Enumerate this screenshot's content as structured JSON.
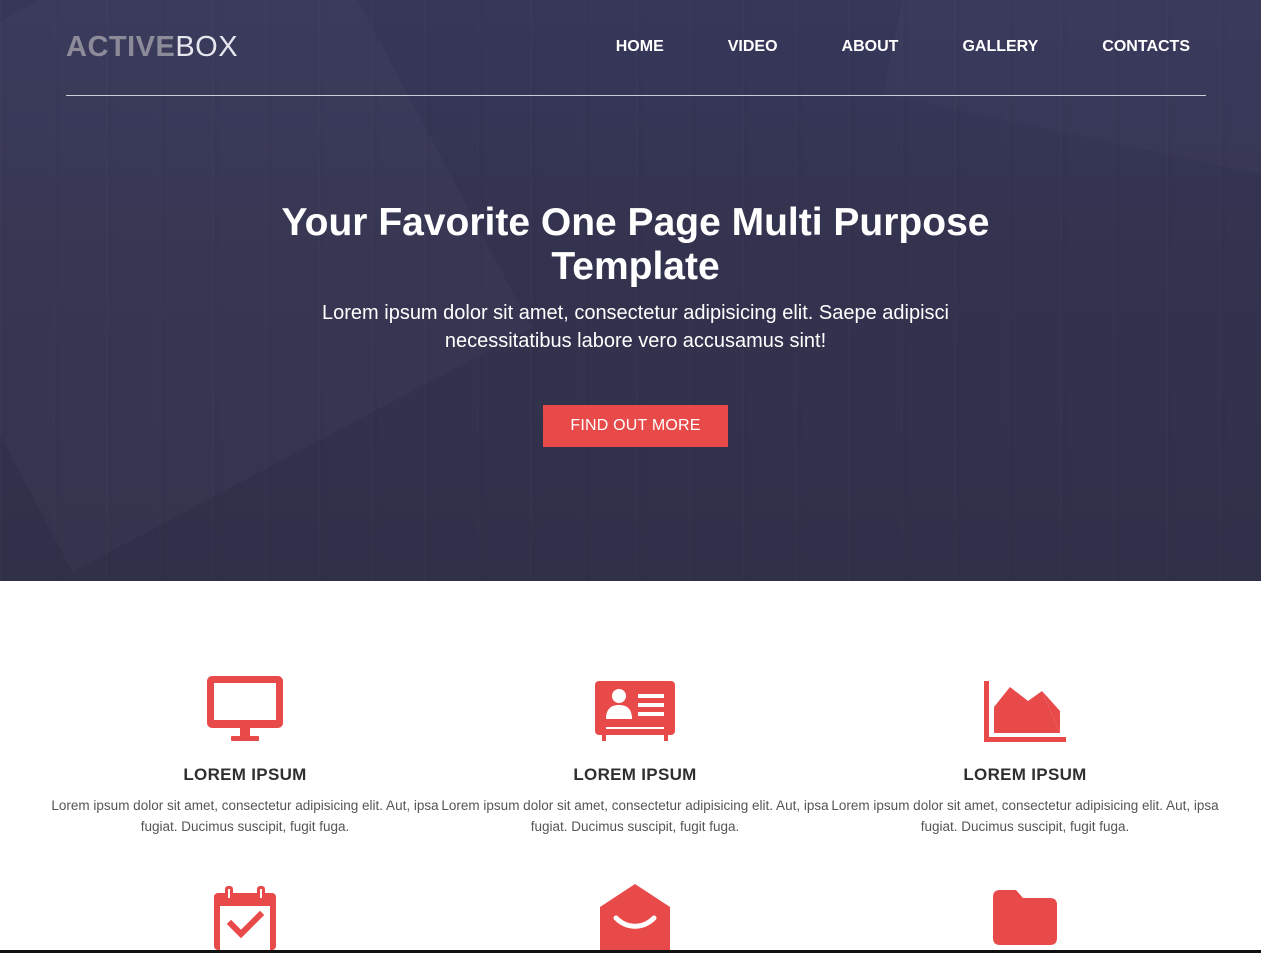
{
  "brand": {
    "bold": "ACTIVE",
    "light": "BOX"
  },
  "nav": {
    "items": [
      {
        "label": "HOME"
      },
      {
        "label": "VIDEO"
      },
      {
        "label": "ABOUT"
      },
      {
        "label": "GALLERY"
      },
      {
        "label": "CONTACTS"
      }
    ]
  },
  "hero": {
    "title": "Your Favorite One Page Multi Purpose Template",
    "subtitle": "Lorem ipsum dolor sit amet, consectetur adipisicing elit. Saepe adipisci necessitatibus labore vero accusamus sint!",
    "button": "FIND OUT MORE"
  },
  "features": [
    {
      "icon": "monitor-icon",
      "title": "LOREM IPSUM",
      "text": "Lorem ipsum dolor sit amet, consectetur adipisicing elit. Aut, ipsa fugiat. Ducimus suscipit, fugit fuga."
    },
    {
      "icon": "id-card-icon",
      "title": "LOREM IPSUM",
      "text": "Lorem ipsum dolor sit amet, consectetur adipisicing elit. Aut, ipsa fugiat. Ducimus suscipit, fugit fuga."
    },
    {
      "icon": "area-chart-icon",
      "title": "LOREM IPSUM",
      "text": "Lorem ipsum dolor sit amet, consectetur adipisicing elit. Aut, ipsa fugiat. Ducimus suscipit, fugit fuga."
    },
    {
      "icon": "calendar-check-icon"
    },
    {
      "icon": "envelope-open-icon"
    },
    {
      "icon": "folder-icon"
    }
  ],
  "colors": {
    "accent": "#e84a4a",
    "hero_bg": "#34344f",
    "heading": "#2f2f2f",
    "body_text": "#555555"
  }
}
